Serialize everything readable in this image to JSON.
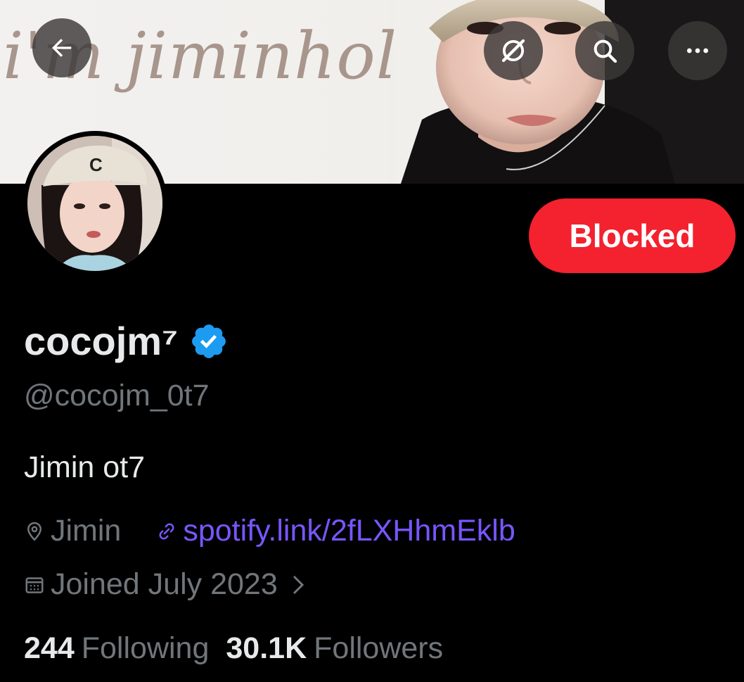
{
  "banner": {
    "script_text": "i'm jiminholic"
  },
  "header_buttons": {
    "back_icon": "arrow-left-icon",
    "grok_icon": "grok-icon",
    "search_icon": "search-icon",
    "more_icon": "more-horizontal-icon"
  },
  "profile": {
    "display_name": "cocojm⁷",
    "verified": true,
    "handle": "@cocojm_0t7",
    "bio": "Jimin ot7",
    "location": "Jimin",
    "link": "spotify.link/2fLXHhmEklb",
    "joined": "Joined July 2023",
    "following_count": "244",
    "following_label": "Following",
    "followers_count": "30.1K",
    "followers_label": "Followers"
  },
  "actions": {
    "blocked_label": "Blocked"
  },
  "colors": {
    "background": "#000000",
    "primary_text": "#e7e9ea",
    "secondary_text": "#71767b",
    "link": "#7856ff",
    "blocked": "#f4212e",
    "verified": "#1d9bf0"
  }
}
